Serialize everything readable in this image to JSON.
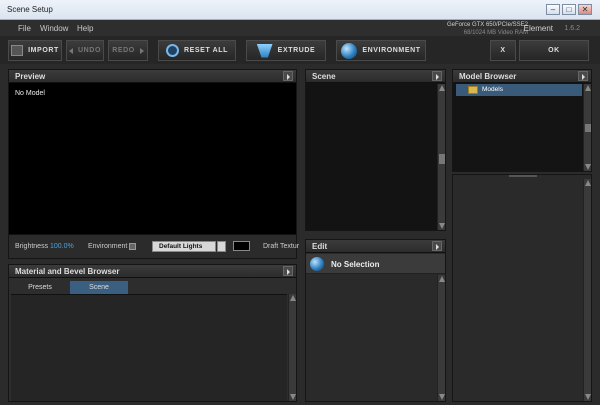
{
  "window": {
    "title": "Scene Setup",
    "minimize": "–",
    "maximize": "□",
    "close": "✕"
  },
  "menu": [
    "File",
    "Window",
    "Help"
  ],
  "gpu": {
    "name": "GeForce GTX 650/PCIe/SSE2",
    "memory": "68/1024 MB Video RAM"
  },
  "app": {
    "name": "Element",
    "version": "1.6.2"
  },
  "toolbar": {
    "import": "IMPORT",
    "undo": "UNDO",
    "redo": "REDO",
    "reset_all": "RESET ALL",
    "extrude": "EXTRUDE",
    "environment": "ENVIRONMENT",
    "cancel": "X",
    "ok": "OK"
  },
  "preview": {
    "title": "Preview",
    "no_model": "No Model",
    "brightness_label": "Brightness",
    "brightness_value": "100.0%",
    "environment_label": "Environment",
    "lights_select": "Default Lights",
    "draft_label": "Draft Textur"
  },
  "scene": {
    "title": "Scene"
  },
  "edit": {
    "title": "Edit",
    "selection": "No Selection"
  },
  "model_browser": {
    "title": "Model Browser",
    "items": [
      "Models"
    ]
  },
  "material_browser": {
    "title": "Material and Bevel Browser",
    "tabs": [
      "Presets",
      "Scene"
    ],
    "active_tab": "Scene"
  },
  "colors": {
    "accent_blue": "#3b5f80",
    "brightness_value": "#4aa3df",
    "selection_highlight": "#3a5a7a"
  }
}
